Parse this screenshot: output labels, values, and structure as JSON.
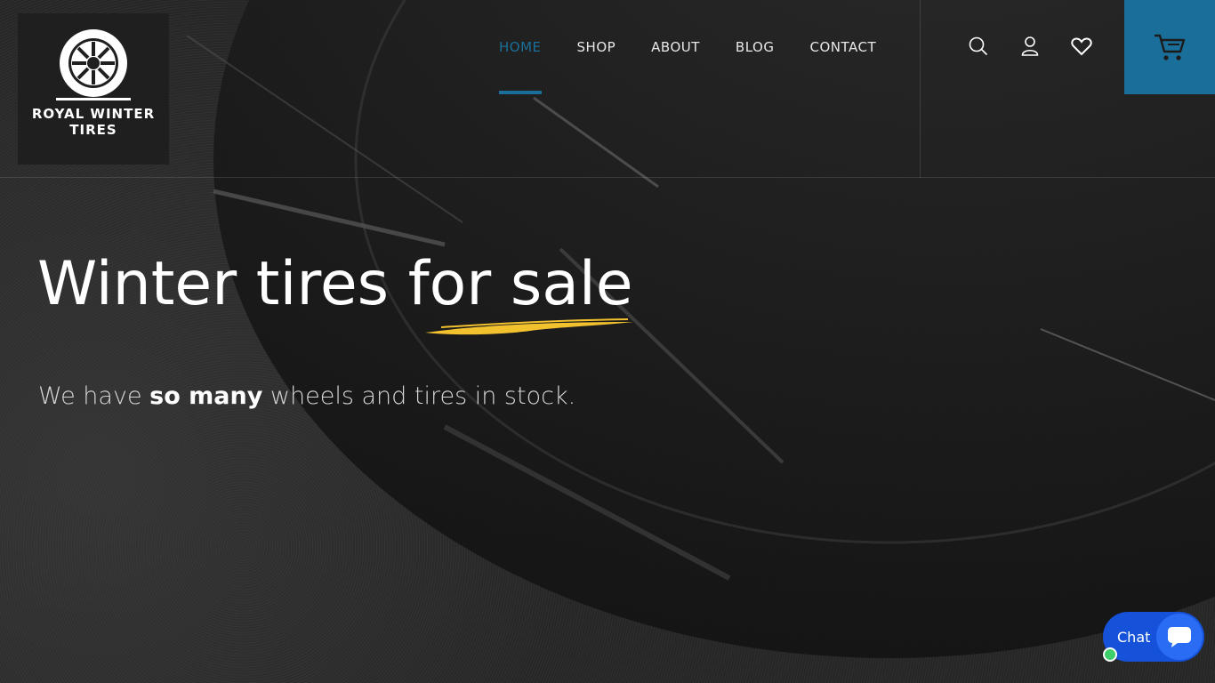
{
  "brand": {
    "name_line1": "ROYAL WINTER",
    "name_line2": "TIRES"
  },
  "nav": {
    "items": [
      {
        "label": "HOME",
        "active": true
      },
      {
        "label": "SHOP",
        "active": false
      },
      {
        "label": "ABOUT",
        "active": false
      },
      {
        "label": "BLOG",
        "active": false
      },
      {
        "label": "CONTACT",
        "active": false
      }
    ]
  },
  "header_icons": [
    "search-icon",
    "user-icon",
    "heart-icon",
    "cart-icon"
  ],
  "hero": {
    "title": "Winter tires for sale",
    "subtitle_pre": "We have ",
    "subtitle_bold": "so many",
    "subtitle_post": " wheels and tires in stock."
  },
  "chat": {
    "label": "Chat"
  },
  "colors": {
    "accent": "#1a6f9a",
    "brush": "#f2c12e",
    "chat": "#1552d9",
    "online": "#3ecf6a"
  }
}
